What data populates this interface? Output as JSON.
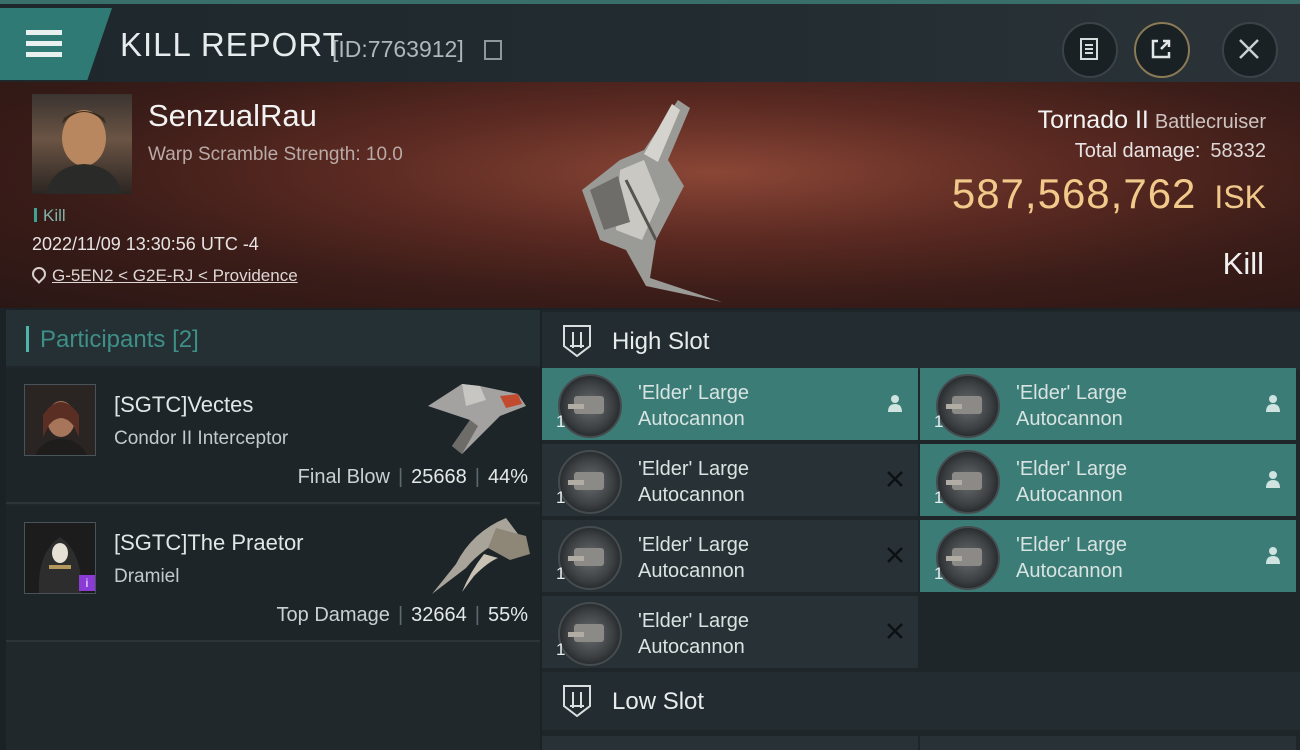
{
  "header": {
    "title": "KILL REPORT",
    "report_id": "[ID:7763912]",
    "menu_icon": "hamburger-icon",
    "buttons": [
      "document-icon",
      "share-icon",
      "close-icon"
    ]
  },
  "victim": {
    "name": "SenzualRau",
    "scram": "Warp Scramble Strength: 10.0",
    "tag": "Kill",
    "datetime": "2022/11/09 13:30:56 UTC -4",
    "location": "G-5EN2 < G2E-RJ < Providence",
    "ship_name": "Tornado II",
    "ship_class": "Battlecruiser",
    "total_damage_label": "Total damage:",
    "total_damage": "58332",
    "isk_value": "587,568,762",
    "isk_unit": "ISK",
    "result": "Kill"
  },
  "participants": {
    "label": "Participants",
    "count": "[2]",
    "list": [
      {
        "name": "[SGTC]Vectes",
        "ship": "Condor II Interceptor",
        "role": "Final Blow",
        "damage": "25668",
        "percent": "44%"
      },
      {
        "name": "[SGTC]The Praetor",
        "ship": "Dramiel",
        "role": "Top Damage",
        "damage": "32664",
        "percent": "55%"
      }
    ]
  },
  "slots": {
    "high_title": "High Slot",
    "low_title": "Low Slot",
    "high": [
      {
        "name": "'Elder' Large\nAutocannon",
        "qty": "1",
        "status": "fitted"
      },
      {
        "name": "'Elder' Large\nAutocannon",
        "qty": "1",
        "status": "fitted"
      },
      {
        "name": "'Elder' Large\nAutocannon",
        "qty": "1",
        "status": "destroyed"
      },
      {
        "name": "'Elder' Large\nAutocannon",
        "qty": "1",
        "status": "fitted"
      },
      {
        "name": "'Elder' Large\nAutocannon",
        "qty": "1",
        "status": "destroyed"
      },
      {
        "name": "'Elder' Large\nAutocannon",
        "qty": "1",
        "status": "fitted"
      },
      {
        "name": "'Elder' Large\nAutocannon",
        "qty": "1",
        "status": "destroyed"
      }
    ]
  },
  "colors": {
    "accent": "#3b7d76",
    "isk": "#f1c98a",
    "banner": "#5b2a22"
  }
}
